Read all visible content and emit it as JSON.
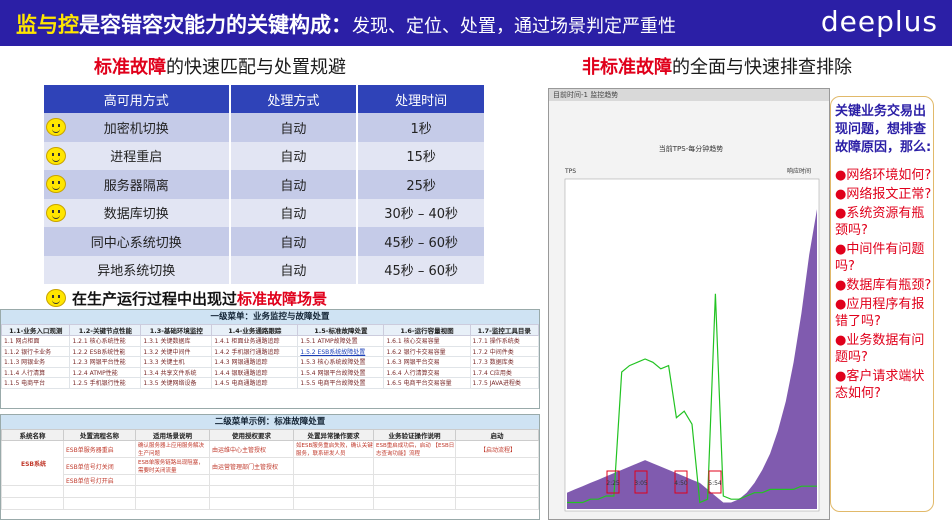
{
  "header": {
    "title_a": "监与控",
    "title_b": "是容错容灾能力的关键构成：",
    "title_c": "发现、定位、处置，通过场景判定严重性",
    "logo": "deeplus"
  },
  "left_title": {
    "red": "标准故障",
    "rest": "的快速匹配与处置规避"
  },
  "right_title": {
    "red": "非标准故障",
    "rest": "的全面与快速排查排除"
  },
  "ha_table": {
    "headers": [
      "高可用方式",
      "处理方式",
      "处理时间"
    ],
    "rows": [
      {
        "method": "加密机切换",
        "handling": "自动",
        "time": "1秒"
      },
      {
        "method": "进程重启",
        "handling": "自动",
        "time": "15秒"
      },
      {
        "method": "服务器隔离",
        "handling": "自动",
        "time": "25秒"
      },
      {
        "method": "数据库切换",
        "handling": "自动",
        "time": "30秒 – 40秒"
      },
      {
        "method": "同中心系统切换",
        "handling": "自动",
        "time": "45秒 – 60秒"
      },
      {
        "method": "异地系统切换",
        "handling": "自动",
        "time": "45秒 – 60秒"
      }
    ]
  },
  "scenario": {
    "prefix": "在生产运行过程中出现过",
    "red": "标准故障场景"
  },
  "menu1": {
    "title": "一级菜单：业务监控与故障处置",
    "headers": [
      "1.1-业务入口观测",
      "1.2-关键节点性能",
      "1.3-基础环境监控",
      "1.4-业务通路跟踪",
      "1.5-标准故障处置",
      "1.6-运行容量视图",
      "1.7-监控工具目录"
    ],
    "rows": [
      [
        "1.1 网点柜面",
        "1.2.1 核心系统性能",
        "1.3.1 关键数据库",
        "1.4.1 柜面业务通路追踪",
        "1.5.1 ATMP故障处置",
        "1.6.1 核心交易容量",
        "1.7.1 操作系统类"
      ],
      [
        "1.1.2 银行卡业务",
        "1.2.2 ESB系统性能",
        "1.3.2 关键中间件",
        "1.4.2 手机银行通路追踪",
        "1.5.2 ESB系统故障处置",
        "1.6.2 银行卡交易容量",
        "1.7.2 中间件类"
      ],
      [
        "1.1.3 网银业务",
        "1.2.3 网银平台性能",
        "1.3.3 关键主机",
        "1.4.3 网银通路追踪",
        "1.5.3 核心系统故障处置",
        "1.6.3 网银平台交易",
        "1.7.3 数据库类"
      ],
      [
        "1.1.4 人行清算",
        "1.2.4 ATMP性能",
        "1.3.4 共享文件系统",
        "1.4.4 银联通路追踪",
        "1.5.4 网银平台故障处置",
        "1.6.4 人行清算交易",
        "1.7.4 C应用类"
      ],
      [
        "1.1.5 电商平台",
        "1.2.5 手机银行性能",
        "1.3.5 关键网络设备",
        "1.4.5 电商通路追踪",
        "1.5.5 电商平台故障处置",
        "1.6.5 电商平台交易容量",
        "1.7.5 JAVA进程类"
      ]
    ]
  },
  "menu2": {
    "title": "二级菜单示例：标准故障处置",
    "headers": [
      "系统名称",
      "处置流程名称",
      "适用场景说明",
      "使用授权要求",
      "处置异常操作要求",
      "业务验证操作说明",
      "启动"
    ],
    "system": "ESB系统",
    "start_label": "【启动流程】",
    "rows": [
      {
        "flow": "ESB单服务器重启",
        "scene": "确认服务器上应用服务解决生产问题",
        "auth": "由运维中心主管授权",
        "op": "如ESB服务重启失败，确认关键服务，联系研发人员",
        "verify": "ESB重启成功后，启动 【ESB日志查询功能】流程"
      },
      {
        "flow": "ESB单信号灯关闭",
        "scene": "ESB单服务链路出现阻塞，需要时关闭流量",
        "auth": "由运营管理部门主管授权",
        "op": "",
        "verify": ""
      },
      {
        "flow": "ESB单信号灯开启",
        "scene": "",
        "auth": "",
        "op": "",
        "verify": ""
      }
    ]
  },
  "chart_window": {
    "window_bar": "目前时间-1 监控趋势",
    "title": "当前TPS-每分钟趋势",
    "ylabel": "TPS",
    "right_label": "响应时间",
    "markers": [
      "2:25",
      "3:05",
      "4:50",
      "5:54"
    ]
  },
  "chart_data": {
    "type": "area",
    "title": "当前TPS-每分钟趋势",
    "series": [
      {
        "values": [
          0.05,
          0.06,
          0.07,
          0.08,
          0.09,
          0.1,
          0.11,
          0.12,
          0.13,
          0.14,
          0.15,
          0.14,
          0.13,
          0.12,
          0.11,
          0.1,
          0.09,
          0.08,
          0.06,
          0.04,
          0.02,
          0.02,
          0.03,
          0.05,
          0.08,
          0.12,
          0.17,
          0.24,
          0.33,
          0.45,
          0.6,
          0.78,
          0.92
        ]
      },
      {
        "values": [
          0.02,
          0.02,
          0.02,
          0.03,
          0.03,
          0.04,
          0.04,
          0.42,
          0.44,
          0.45,
          0.46,
          0.45,
          0.43,
          0.44,
          0.28,
          0.3,
          0.26,
          0.02,
          0.03,
          0.66,
          0.04,
          0.03,
          0.03,
          0.04,
          0.05,
          0.05,
          0.06,
          0.06,
          0.06,
          0.06,
          0.07,
          0.07,
          0.07
        ]
      }
    ]
  },
  "right_panel": {
    "lead": "关键业务交易出现问题，想排查故障原因，那么:",
    "items": [
      "●网络环境如何?",
      "●网络报文正常?",
      "●系统资源有瓶颈吗?",
      "●中间件有问题吗?",
      "●数据库有瓶颈?",
      "●应用程序有报错了吗?",
      "●业务数据有问题吗?",
      "●客户请求端状态如何?"
    ]
  },
  "colors": {
    "header_bg": "#2b1fa6",
    "accent_yellow": "#ffe600",
    "accent_red": "#e0001b",
    "table_header": "#2f43b8"
  }
}
